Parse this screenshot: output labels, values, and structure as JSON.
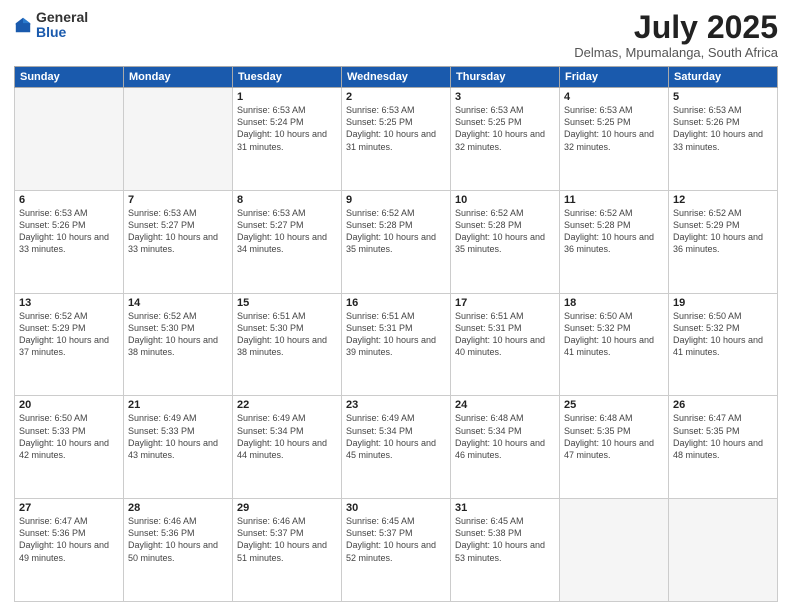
{
  "header": {
    "logo_general": "General",
    "logo_blue": "Blue",
    "month_title": "July 2025",
    "subtitle": "Delmas, Mpumalanga, South Africa"
  },
  "weekdays": [
    "Sunday",
    "Monday",
    "Tuesday",
    "Wednesday",
    "Thursday",
    "Friday",
    "Saturday"
  ],
  "weeks": [
    [
      {
        "day": "",
        "empty": true
      },
      {
        "day": "",
        "empty": true
      },
      {
        "day": "1",
        "sunrise": "6:53 AM",
        "sunset": "5:24 PM",
        "daylight": "10 hours and 31 minutes."
      },
      {
        "day": "2",
        "sunrise": "6:53 AM",
        "sunset": "5:25 PM",
        "daylight": "10 hours and 31 minutes."
      },
      {
        "day": "3",
        "sunrise": "6:53 AM",
        "sunset": "5:25 PM",
        "daylight": "10 hours and 32 minutes."
      },
      {
        "day": "4",
        "sunrise": "6:53 AM",
        "sunset": "5:25 PM",
        "daylight": "10 hours and 32 minutes."
      },
      {
        "day": "5",
        "sunrise": "6:53 AM",
        "sunset": "5:26 PM",
        "daylight": "10 hours and 33 minutes."
      }
    ],
    [
      {
        "day": "6",
        "sunrise": "6:53 AM",
        "sunset": "5:26 PM",
        "daylight": "10 hours and 33 minutes."
      },
      {
        "day": "7",
        "sunrise": "6:53 AM",
        "sunset": "5:27 PM",
        "daylight": "10 hours and 33 minutes."
      },
      {
        "day": "8",
        "sunrise": "6:53 AM",
        "sunset": "5:27 PM",
        "daylight": "10 hours and 34 minutes."
      },
      {
        "day": "9",
        "sunrise": "6:52 AM",
        "sunset": "5:28 PM",
        "daylight": "10 hours and 35 minutes."
      },
      {
        "day": "10",
        "sunrise": "6:52 AM",
        "sunset": "5:28 PM",
        "daylight": "10 hours and 35 minutes."
      },
      {
        "day": "11",
        "sunrise": "6:52 AM",
        "sunset": "5:28 PM",
        "daylight": "10 hours and 36 minutes."
      },
      {
        "day": "12",
        "sunrise": "6:52 AM",
        "sunset": "5:29 PM",
        "daylight": "10 hours and 36 minutes."
      }
    ],
    [
      {
        "day": "13",
        "sunrise": "6:52 AM",
        "sunset": "5:29 PM",
        "daylight": "10 hours and 37 minutes."
      },
      {
        "day": "14",
        "sunrise": "6:52 AM",
        "sunset": "5:30 PM",
        "daylight": "10 hours and 38 minutes."
      },
      {
        "day": "15",
        "sunrise": "6:51 AM",
        "sunset": "5:30 PM",
        "daylight": "10 hours and 38 minutes."
      },
      {
        "day": "16",
        "sunrise": "6:51 AM",
        "sunset": "5:31 PM",
        "daylight": "10 hours and 39 minutes."
      },
      {
        "day": "17",
        "sunrise": "6:51 AM",
        "sunset": "5:31 PM",
        "daylight": "10 hours and 40 minutes."
      },
      {
        "day": "18",
        "sunrise": "6:50 AM",
        "sunset": "5:32 PM",
        "daylight": "10 hours and 41 minutes."
      },
      {
        "day": "19",
        "sunrise": "6:50 AM",
        "sunset": "5:32 PM",
        "daylight": "10 hours and 41 minutes."
      }
    ],
    [
      {
        "day": "20",
        "sunrise": "6:50 AM",
        "sunset": "5:33 PM",
        "daylight": "10 hours and 42 minutes."
      },
      {
        "day": "21",
        "sunrise": "6:49 AM",
        "sunset": "5:33 PM",
        "daylight": "10 hours and 43 minutes."
      },
      {
        "day": "22",
        "sunrise": "6:49 AM",
        "sunset": "5:34 PM",
        "daylight": "10 hours and 44 minutes."
      },
      {
        "day": "23",
        "sunrise": "6:49 AM",
        "sunset": "5:34 PM",
        "daylight": "10 hours and 45 minutes."
      },
      {
        "day": "24",
        "sunrise": "6:48 AM",
        "sunset": "5:34 PM",
        "daylight": "10 hours and 46 minutes."
      },
      {
        "day": "25",
        "sunrise": "6:48 AM",
        "sunset": "5:35 PM",
        "daylight": "10 hours and 47 minutes."
      },
      {
        "day": "26",
        "sunrise": "6:47 AM",
        "sunset": "5:35 PM",
        "daylight": "10 hours and 48 minutes."
      }
    ],
    [
      {
        "day": "27",
        "sunrise": "6:47 AM",
        "sunset": "5:36 PM",
        "daylight": "10 hours and 49 minutes."
      },
      {
        "day": "28",
        "sunrise": "6:46 AM",
        "sunset": "5:36 PM",
        "daylight": "10 hours and 50 minutes."
      },
      {
        "day": "29",
        "sunrise": "6:46 AM",
        "sunset": "5:37 PM",
        "daylight": "10 hours and 51 minutes."
      },
      {
        "day": "30",
        "sunrise": "6:45 AM",
        "sunset": "5:37 PM",
        "daylight": "10 hours and 52 minutes."
      },
      {
        "day": "31",
        "sunrise": "6:45 AM",
        "sunset": "5:38 PM",
        "daylight": "10 hours and 53 minutes."
      },
      {
        "day": "",
        "empty": true
      },
      {
        "day": "",
        "empty": true
      }
    ]
  ],
  "labels": {
    "sunrise": "Sunrise:",
    "sunset": "Sunset:",
    "daylight": "Daylight:"
  }
}
